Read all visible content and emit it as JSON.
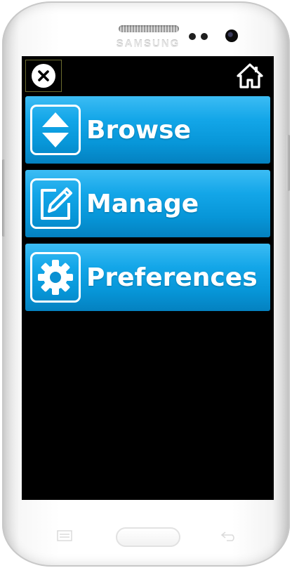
{
  "device": {
    "brand": "SAMSUNG"
  },
  "topbar": {
    "close_icon": "close-circle-x",
    "home_icon": "house"
  },
  "menu": {
    "items": [
      {
        "label": "Browse",
        "icon": "up-down-arrows"
      },
      {
        "label": "Manage",
        "icon": "pencil-square"
      },
      {
        "label": "Preferences",
        "icon": "gear"
      }
    ]
  },
  "colors": {
    "screen_bg": "#000000",
    "button_blue": "#0796d8",
    "button_text": "#ffffff"
  }
}
